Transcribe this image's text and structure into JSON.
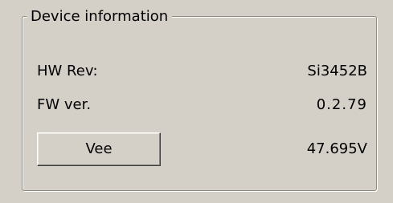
{
  "device_information": {
    "title": "Device information",
    "hw_rev": {
      "label": "HW Rev:",
      "value": "Si3452B"
    },
    "fw_ver": {
      "label": "FW ver.",
      "value": "0.2.79"
    },
    "vee": {
      "button_label": "Vee",
      "value": "47.695V"
    }
  },
  "colors": {
    "background": "#d4d0c8",
    "border_shadow": "#8e8b83",
    "border_highlight": "#ffffff",
    "text": "#000000"
  }
}
